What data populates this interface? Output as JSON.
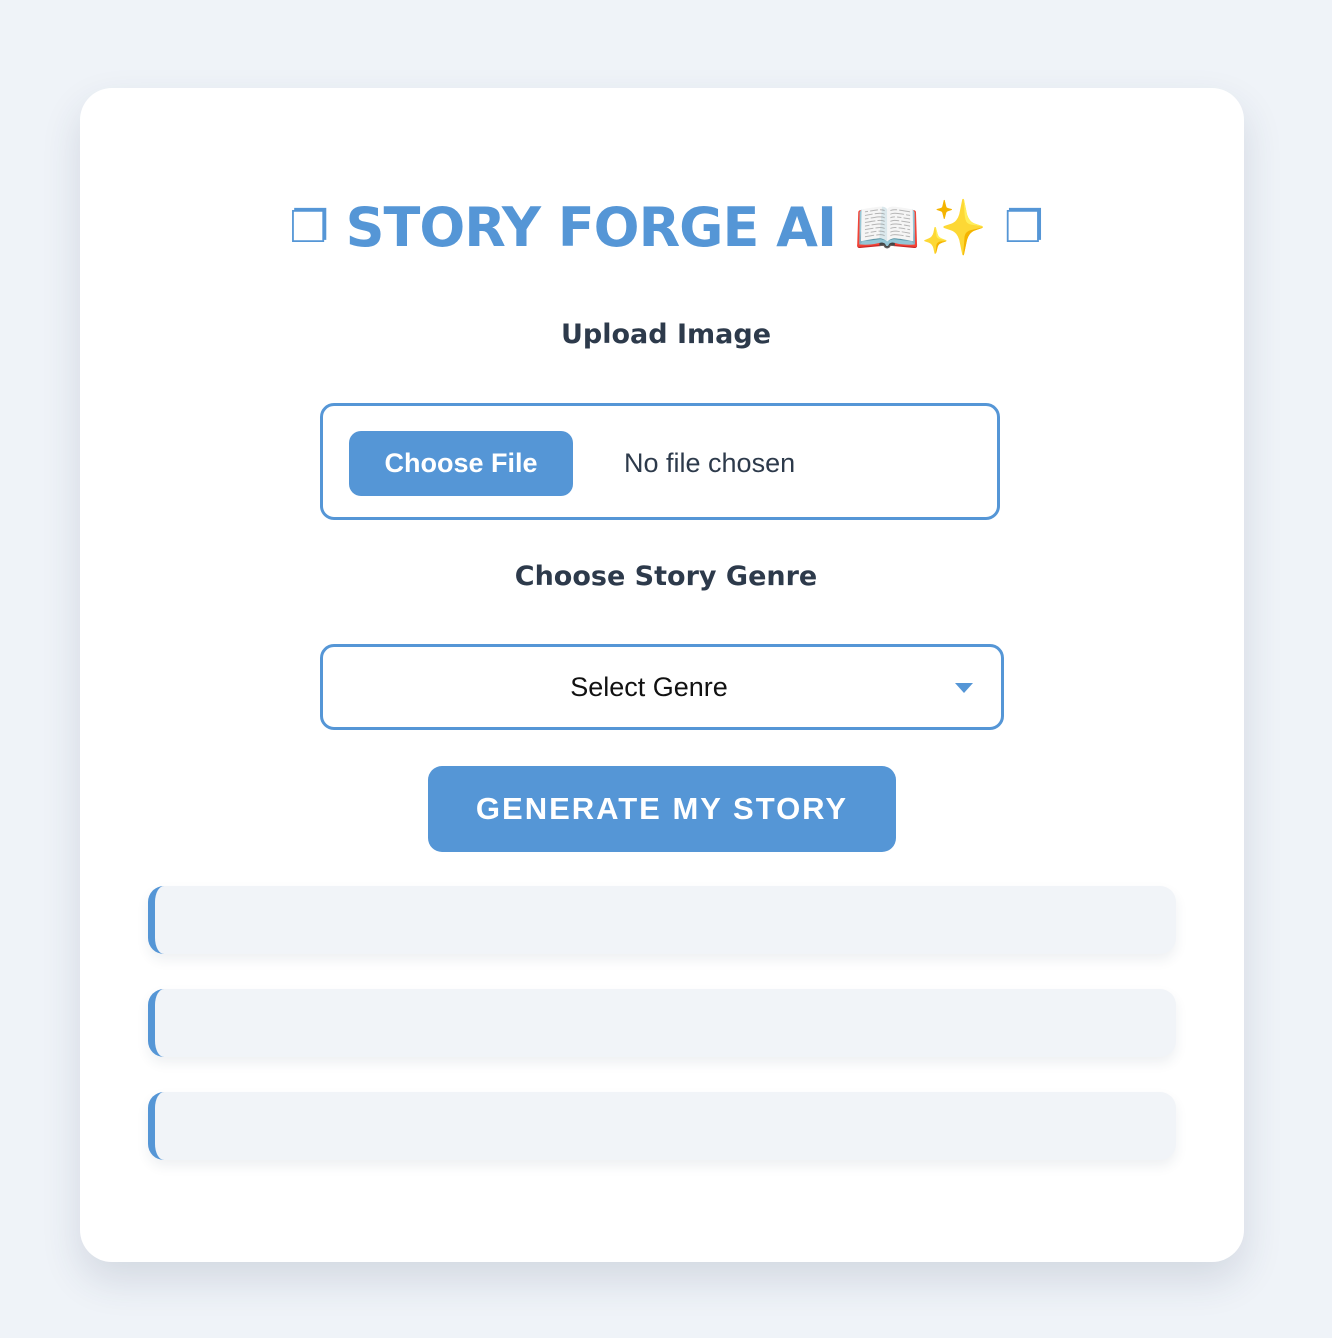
{
  "app": {
    "title": "STORY FORGE AI",
    "title_emoji": "📖✨",
    "title_deco_left": "❐",
    "title_deco_right": "❐"
  },
  "upload": {
    "label": "Upload Image",
    "button_label": "Choose File",
    "status_text": "No file chosen"
  },
  "genre": {
    "label": "Choose Story Genre",
    "selected_value": "Select Genre",
    "caret_icon": "caret-down-icon"
  },
  "actions": {
    "generate_label": "GENERATE MY STORY"
  },
  "output_panels": [
    {
      "text": ""
    },
    {
      "text": ""
    },
    {
      "text": ""
    }
  ],
  "colors": {
    "accent": "#5596d6",
    "page_background": "#eff3f8",
    "card_background": "#ffffff",
    "panel_background": "#f1f4f8",
    "label_text": "#2d3a4b"
  }
}
